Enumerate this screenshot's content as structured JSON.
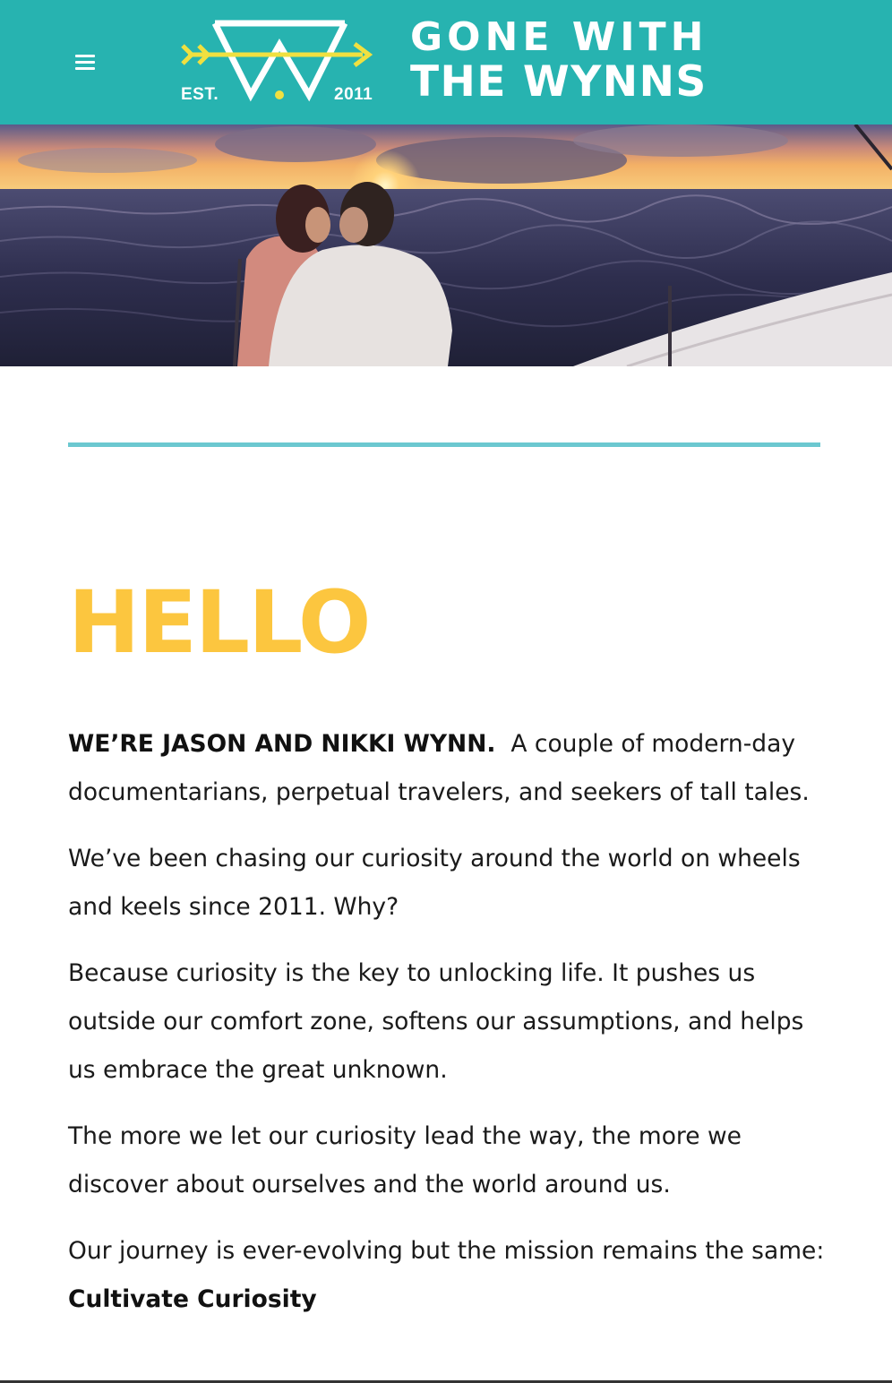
{
  "header": {
    "menu_icon": "hamburger-menu-icon",
    "logo": {
      "est_label": "EST.",
      "year_label": "2011",
      "line1": "GONE WITH",
      "line2": "THE WYNNS",
      "brand_color": "#27b3b0",
      "accent_color": "#f0e040"
    }
  },
  "hero": {
    "description_icon": "sunset-sailing-photo"
  },
  "main": {
    "heading": "HELLO",
    "heading_color": "#fcc63f",
    "divider_color": "#6cc8d0",
    "intro_bold": "WE’RE JASON AND NIKKI WYNN.",
    "intro_text": "A couple of modern-day documentarians, perpetual travelers, and seekers of tall tales.",
    "paragraph_2": "We’ve been chasing our curiosity around the world on wheels and keels since 2011.  Why?",
    "paragraph_3": "Because curiosity is the key to unlocking life.  It pushes us outside our comfort zone, softens our assumptions, and helps us embrace the great unknown.",
    "paragraph_4": "The more we let our curiosity lead the way, the more we discover about ourselves and the world around us.",
    "paragraph_5_text": "Our journey is ever-evolving but the mission remains the same:",
    "paragraph_5_bold": "Cultivate Curiosity"
  }
}
